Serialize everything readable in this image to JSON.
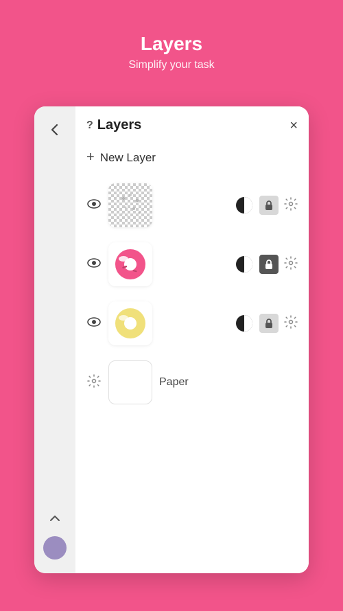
{
  "header": {
    "title": "Layers",
    "subtitle": "Simplify your task"
  },
  "panel": {
    "title": "Layers",
    "help_symbol": "?",
    "close_label": "×",
    "new_layer_label": "New Layer",
    "layers": [
      {
        "id": "layer-1",
        "visible": true,
        "type": "dots",
        "locked": false
      },
      {
        "id": "layer-2",
        "visible": true,
        "type": "donut-pink",
        "locked": true
      },
      {
        "id": "layer-3",
        "visible": true,
        "type": "donut-yellow",
        "locked": false
      }
    ],
    "paper": {
      "label": "Paper"
    }
  },
  "sidebar": {
    "color": "#9B8DC0"
  }
}
